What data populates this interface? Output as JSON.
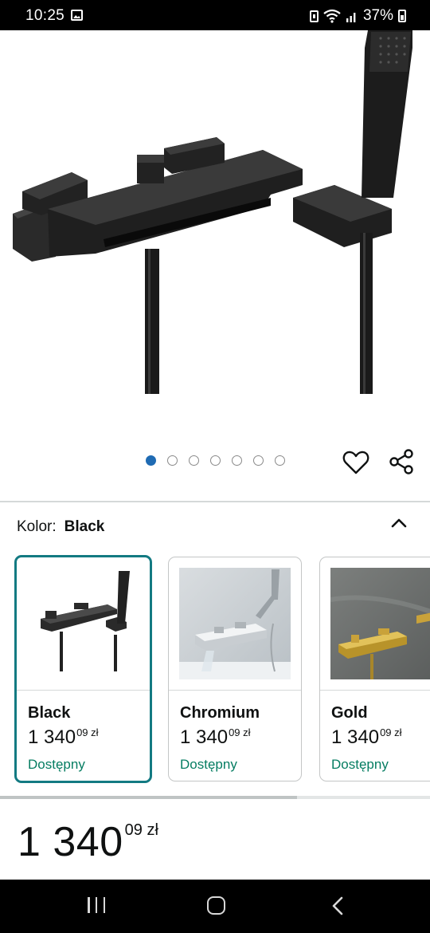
{
  "status_bar": {
    "time": "10:25",
    "battery_percent": "37%",
    "icons": [
      "gallery-icon",
      "battery-saver-icon",
      "wifi-icon",
      "signal-icon",
      "battery-icon"
    ]
  },
  "product": {
    "image_alt": "black-waterfall-bath-faucet-with-hand-shower",
    "carousel": {
      "count": 7,
      "active_index": 0
    },
    "actions": [
      "heart-icon",
      "share-icon"
    ]
  },
  "color_selector": {
    "label": "Kolor:",
    "selected_value": "Black",
    "collapse_icon": "chevron-up-icon",
    "options": [
      {
        "name": "Black",
        "price_main": "1 340",
        "price_fraction": "09 zł",
        "availability": "Dostępny",
        "selected": true
      },
      {
        "name": "Chromium",
        "price_main": "1 340",
        "price_fraction": "09 zł",
        "availability": "Dostępny",
        "selected": false
      },
      {
        "name": "Gold",
        "price_main": "1 340",
        "price_fraction": "09 zł",
        "availability": "Dostępny",
        "selected": false
      }
    ],
    "scroll_position": 0.69
  },
  "price": {
    "main": "1 340",
    "fraction": "09 zł"
  },
  "colors": {
    "selected_border": "#137a82",
    "availability_green": "#067d62",
    "active_dot": "#1f6bb3"
  },
  "nav_bar": {
    "icons": [
      "recent-apps-icon",
      "home-icon",
      "back-icon"
    ]
  }
}
